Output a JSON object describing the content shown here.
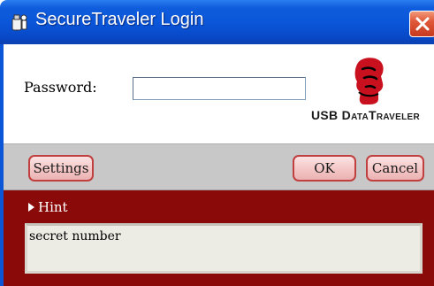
{
  "window": {
    "title": "SecureTraveler Login",
    "app_icon": "usb-drive-icon",
    "close_icon": "close-icon"
  },
  "form": {
    "password_label": "Password:",
    "password_value": ""
  },
  "logo": {
    "icon": "kingston-head-icon",
    "text_prefix": "USB ",
    "text_main": "DataTraveler"
  },
  "buttons": {
    "settings_label": "Settings",
    "ok_label": "OK",
    "cancel_label": "Cancel"
  },
  "hint": {
    "toggle_label": "Hint",
    "text": "secret number"
  },
  "colors": {
    "titlebar": "#0a55d8",
    "accent_red": "#8a0a0a",
    "button_fill": "#f3c4c4",
    "button_border": "#c04040",
    "band_gray": "#c8c8c8"
  }
}
